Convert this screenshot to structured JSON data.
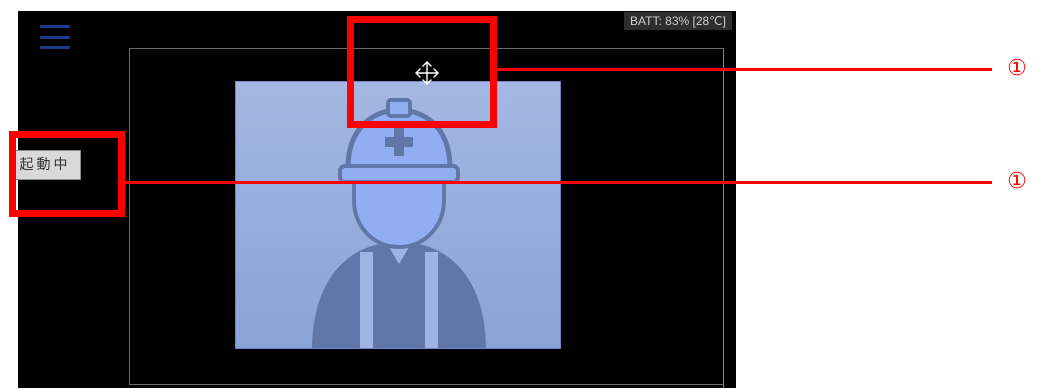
{
  "status": {
    "battery_text": "BATT: 83%  [28℃]"
  },
  "controls": {
    "start_button_label": "起動中"
  },
  "icons": {
    "menu": "hamburger-menu-icon",
    "move": "move-arrows-icon",
    "worker": "worker-hardhat-icon"
  },
  "annotations": {
    "label_1": "①",
    "label_2": "①"
  },
  "colors": {
    "screen_bg": "#000000",
    "camera_view_bg": "#a5b7e2",
    "worker_fill": "#6177a8",
    "annotation": "#ff0000",
    "menu_icon": "#1e3a8a"
  }
}
